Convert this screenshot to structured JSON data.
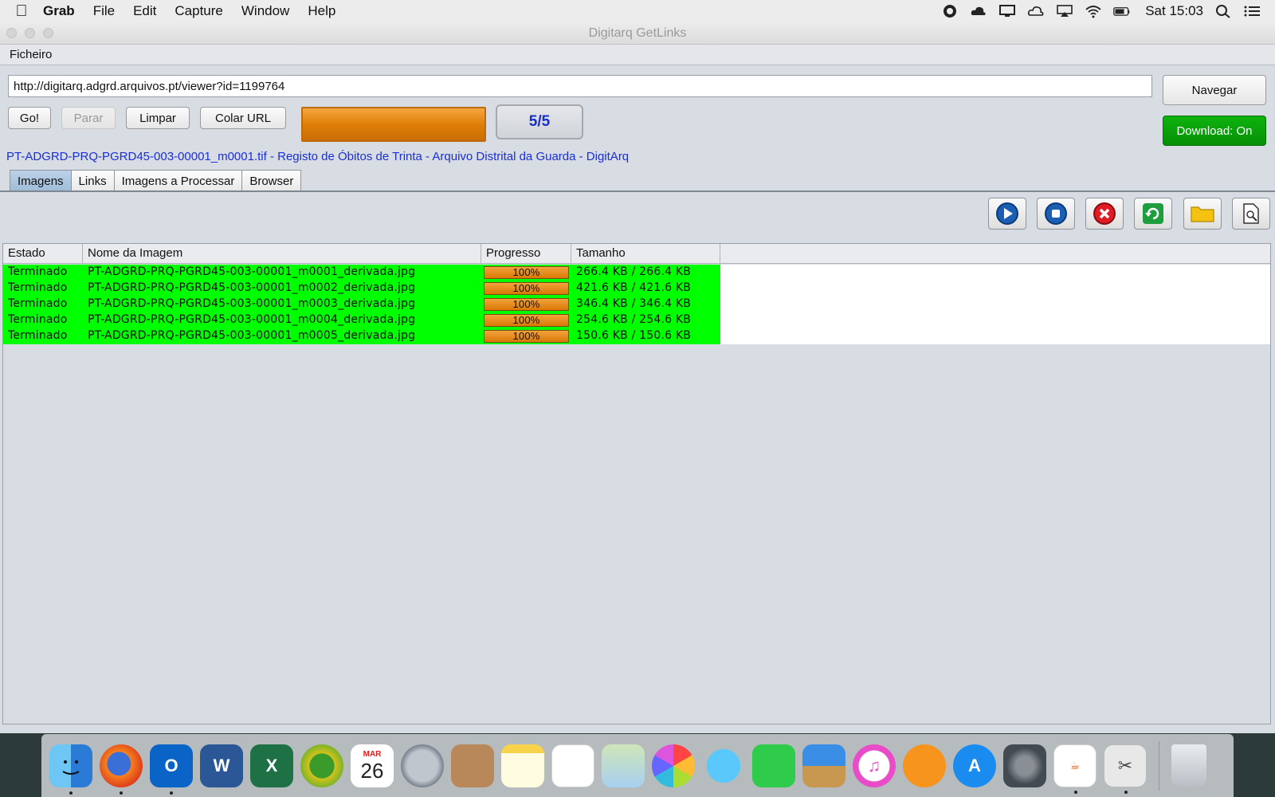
{
  "menubar": {
    "app_name": "Grab",
    "items": [
      "File",
      "Edit",
      "Capture",
      "Window",
      "Help"
    ],
    "clock": "Sat 15:03"
  },
  "window": {
    "title": "Digitarq GetLinks",
    "menu_file": "Ficheiro"
  },
  "toolbar": {
    "url_value": "http://digitarq.adgrd.arquivos.pt/viewer?id=1199764",
    "go_label": "Go!",
    "stop_label": "Parar",
    "clear_label": "Limpar",
    "paste_url_label": "Colar URL",
    "navigate_label": "Navegar",
    "download_label": "Download: On",
    "overall_progress": 1.0,
    "counter": "5/5"
  },
  "info_line": "PT-ADGRD-PRQ-PGRD45-003-00001_m0001.tif - Registo de Óbitos de Trinta - Arquivo Distrital da Guarda - DigitArq",
  "tabs": [
    "Imagens",
    "Links",
    "Imagens a Processar",
    "Browser"
  ],
  "active_tab": "Imagens",
  "actions": [
    "play-icon",
    "stop-icon",
    "cancel-icon",
    "refresh-icon",
    "folder-icon",
    "file-tools-icon"
  ],
  "table": {
    "headers": [
      "Estado",
      "Nome da Imagem",
      "Progresso",
      "Tamanho"
    ],
    "rows": [
      {
        "estado": "Terminado",
        "nome": "PT-ADGRD-PRQ-PGRD45-003-00001_m0001_derivada.jpg",
        "progresso": "100%",
        "tamanho": "266.4  KB / 266.4  KB"
      },
      {
        "estado": "Terminado",
        "nome": "PT-ADGRD-PRQ-PGRD45-003-00001_m0002_derivada.jpg",
        "progresso": "100%",
        "tamanho": "421.6  KB / 421.6  KB"
      },
      {
        "estado": "Terminado",
        "nome": "PT-ADGRD-PRQ-PGRD45-003-00001_m0003_derivada.jpg",
        "progresso": "100%",
        "tamanho": "346.4  KB / 346.4  KB"
      },
      {
        "estado": "Terminado",
        "nome": "PT-ADGRD-PRQ-PGRD45-003-00001_m0004_derivada.jpg",
        "progresso": "100%",
        "tamanho": "254.6  KB / 254.6  KB"
      },
      {
        "estado": "Terminado",
        "nome": "PT-ADGRD-PRQ-PGRD45-003-00001_m0005_derivada.jpg",
        "progresso": "100%",
        "tamanho": "150.6  KB / 150.6  KB"
      }
    ],
    "row_color": "#00ff00"
  },
  "dock": {
    "calendar_month": "MAR",
    "calendar_day": "26",
    "apps": [
      "finder",
      "firefox",
      "outlook",
      "word",
      "excel",
      "mindnode",
      "calendar",
      "launchpad",
      "contacts",
      "notes",
      "reminders",
      "maps",
      "photos",
      "messages",
      "facetime",
      "keynote",
      "itunes",
      "ibooks",
      "app-store",
      "system-preferences",
      "java",
      "grab",
      "trash"
    ]
  }
}
